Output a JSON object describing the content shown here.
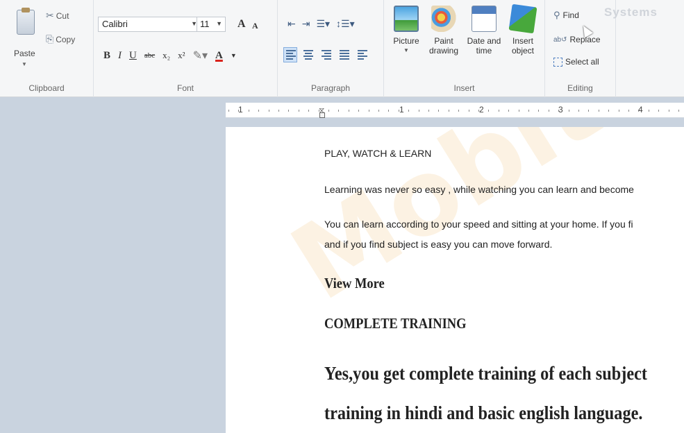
{
  "ribbon": {
    "clipboard": {
      "label": "Clipboard",
      "paste_label": "Paste",
      "cut_label": "Cut",
      "copy_label": "Copy"
    },
    "font": {
      "label": "Font",
      "font_name": "Calibri",
      "font_size": "11",
      "grow_symbol": "A",
      "shrink_symbol": "A",
      "bold": "B",
      "italic": "I",
      "underline": "U",
      "strikethrough": "abc",
      "subscript": "x₂",
      "superscript": "x²",
      "text_color_symbol": "A"
    },
    "paragraph": {
      "label": "Paragraph"
    },
    "insert": {
      "label": "Insert",
      "picture_label": "Picture",
      "paint_label": "Paint drawing",
      "datetime_label": "Date and time",
      "object_label": "Insert object"
    },
    "editing": {
      "label": "Editing",
      "find_label": "Find",
      "replace_label": "Replace",
      "select_all_label": "Select all"
    },
    "brand_ghost": "Systems"
  },
  "ruler": {
    "numbers": [
      "1",
      "1",
      "2",
      "3",
      "4"
    ]
  },
  "document": {
    "watermark": "Mobiteq",
    "line1": "PLAY, WATCH & LEARN",
    "line2": "Learning was never so easy , while watching you can learn and become",
    "line3": "You can learn according to your speed and sitting at your home. If you fi",
    "line4": "and if you find subject is easy you can move forward.",
    "line5": "View More",
    "line6": "COMPLETE TRAINING",
    "line7": "Yes,you get complete training of each subject",
    "line8": "training in hindi and basic english language."
  }
}
